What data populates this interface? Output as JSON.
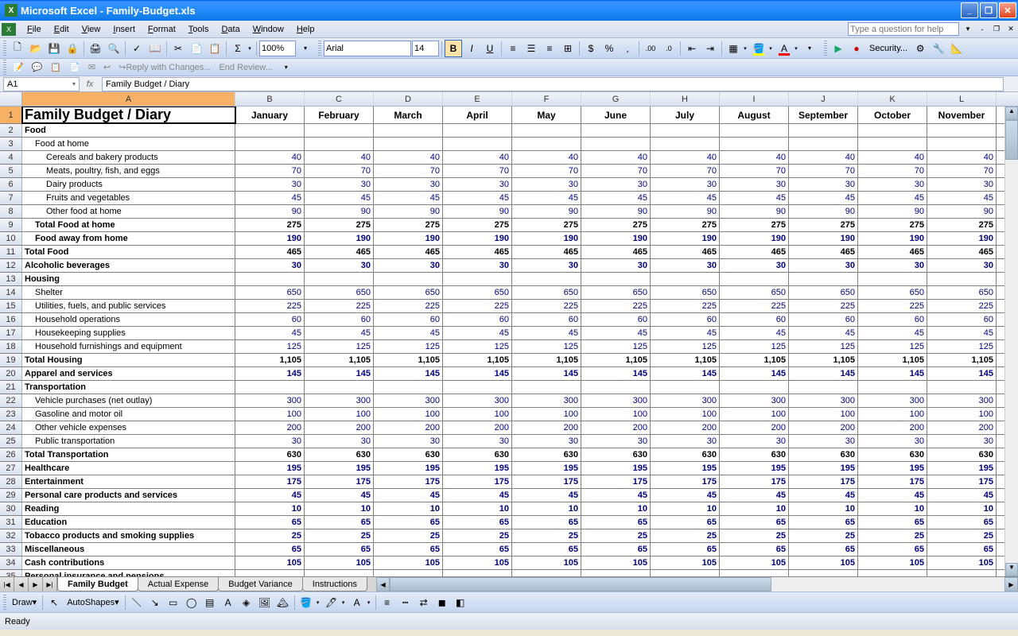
{
  "title": "Microsoft Excel - Family-Budget.xls",
  "menu": [
    "File",
    "Edit",
    "View",
    "Insert",
    "Format",
    "Tools",
    "Data",
    "Window",
    "Help"
  ],
  "help_placeholder": "Type a question for help",
  "toolbar": {
    "font_name": "Arial",
    "font_size": "14",
    "zoom": "100%",
    "security_label": "Security..."
  },
  "review": {
    "reply": "Reply with Changes...",
    "end": "End Review..."
  },
  "namebox": "A1",
  "formula": "Family Budget / Diary",
  "columns": [
    "A",
    "B",
    "C",
    "D",
    "E",
    "F",
    "G",
    "H",
    "I",
    "J",
    "K",
    "L"
  ],
  "months": [
    "January",
    "February",
    "March",
    "April",
    "May",
    "June",
    "July",
    "August",
    "September",
    "October",
    "November"
  ],
  "rows": [
    {
      "n": 1,
      "type": "header",
      "label": "Family Budget / Diary"
    },
    {
      "n": 2,
      "label": "Food",
      "bold": true,
      "vals": []
    },
    {
      "n": 3,
      "label": "Food at home",
      "indent": 1,
      "vals": []
    },
    {
      "n": 4,
      "label": "Cereals and bakery products",
      "indent": 2,
      "vals": [
        40,
        40,
        40,
        40,
        40,
        40,
        40,
        40,
        40,
        40,
        40
      ]
    },
    {
      "n": 5,
      "label": "Meats, poultry, fish, and eggs",
      "indent": 2,
      "vals": [
        70,
        70,
        70,
        70,
        70,
        70,
        70,
        70,
        70,
        70,
        70
      ]
    },
    {
      "n": 6,
      "label": "Dairy products",
      "indent": 2,
      "vals": [
        30,
        30,
        30,
        30,
        30,
        30,
        30,
        30,
        30,
        30,
        30
      ]
    },
    {
      "n": 7,
      "label": "Fruits and vegetables",
      "indent": 2,
      "vals": [
        45,
        45,
        45,
        45,
        45,
        45,
        45,
        45,
        45,
        45,
        45
      ]
    },
    {
      "n": 8,
      "label": "Other food at home",
      "indent": 2,
      "vals": [
        90,
        90,
        90,
        90,
        90,
        90,
        90,
        90,
        90,
        90,
        90
      ]
    },
    {
      "n": 9,
      "label": "Total Food at home",
      "bold": true,
      "indent": 1,
      "vals": [
        275,
        275,
        275,
        275,
        275,
        275,
        275,
        275,
        275,
        275,
        275
      ],
      "black": true
    },
    {
      "n": 10,
      "label": "Food away from home",
      "bold": true,
      "indent": 1,
      "vals": [
        190,
        190,
        190,
        190,
        190,
        190,
        190,
        190,
        190,
        190,
        190
      ]
    },
    {
      "n": 11,
      "label": "Total Food",
      "bold": true,
      "vals": [
        465,
        465,
        465,
        465,
        465,
        465,
        465,
        465,
        465,
        465,
        465
      ],
      "black": true
    },
    {
      "n": 12,
      "label": "Alcoholic beverages",
      "bold": true,
      "vals": [
        30,
        30,
        30,
        30,
        30,
        30,
        30,
        30,
        30,
        30,
        30
      ]
    },
    {
      "n": 13,
      "label": "Housing",
      "bold": true,
      "vals": []
    },
    {
      "n": 14,
      "label": "Shelter",
      "indent": 1,
      "vals": [
        650,
        650,
        650,
        650,
        650,
        650,
        650,
        650,
        650,
        650,
        650
      ]
    },
    {
      "n": 15,
      "label": "Utilities, fuels, and public services",
      "indent": 1,
      "vals": [
        225,
        225,
        225,
        225,
        225,
        225,
        225,
        225,
        225,
        225,
        225
      ]
    },
    {
      "n": 16,
      "label": "Household operations",
      "indent": 1,
      "vals": [
        60,
        60,
        60,
        60,
        60,
        60,
        60,
        60,
        60,
        60,
        60
      ]
    },
    {
      "n": 17,
      "label": "Housekeeping supplies",
      "indent": 1,
      "vals": [
        45,
        45,
        45,
        45,
        45,
        45,
        45,
        45,
        45,
        45,
        45
      ]
    },
    {
      "n": 18,
      "label": "Household furnishings and equipment",
      "indent": 1,
      "vals": [
        125,
        125,
        125,
        125,
        125,
        125,
        125,
        125,
        125,
        125,
        125
      ]
    },
    {
      "n": 19,
      "label": "Total Housing",
      "bold": true,
      "vals": [
        "1,105",
        "1,105",
        "1,105",
        "1,105",
        "1,105",
        "1,105",
        "1,105",
        "1,105",
        "1,105",
        "1,105",
        "1,105"
      ],
      "black": true
    },
    {
      "n": 20,
      "label": "Apparel and services",
      "bold": true,
      "vals": [
        145,
        145,
        145,
        145,
        145,
        145,
        145,
        145,
        145,
        145,
        145
      ]
    },
    {
      "n": 21,
      "label": "Transportation",
      "bold": true,
      "vals": []
    },
    {
      "n": 22,
      "label": "Vehicle purchases (net outlay)",
      "indent": 1,
      "vals": [
        300,
        300,
        300,
        300,
        300,
        300,
        300,
        300,
        300,
        300,
        300
      ]
    },
    {
      "n": 23,
      "label": "Gasoline and motor oil",
      "indent": 1,
      "vals": [
        100,
        100,
        100,
        100,
        100,
        100,
        100,
        100,
        100,
        100,
        100
      ]
    },
    {
      "n": 24,
      "label": "Other vehicle expenses",
      "indent": 1,
      "vals": [
        200,
        200,
        200,
        200,
        200,
        200,
        200,
        200,
        200,
        200,
        200
      ]
    },
    {
      "n": 25,
      "label": "Public transportation",
      "indent": 1,
      "vals": [
        30,
        30,
        30,
        30,
        30,
        30,
        30,
        30,
        30,
        30,
        30
      ]
    },
    {
      "n": 26,
      "label": "Total Transportation",
      "bold": true,
      "vals": [
        630,
        630,
        630,
        630,
        630,
        630,
        630,
        630,
        630,
        630,
        630
      ],
      "black": true
    },
    {
      "n": 27,
      "label": "Healthcare",
      "bold": true,
      "vals": [
        195,
        195,
        195,
        195,
        195,
        195,
        195,
        195,
        195,
        195,
        195
      ]
    },
    {
      "n": 28,
      "label": "Entertainment",
      "bold": true,
      "vals": [
        175,
        175,
        175,
        175,
        175,
        175,
        175,
        175,
        175,
        175,
        175
      ]
    },
    {
      "n": 29,
      "label": "Personal care products and services",
      "bold": true,
      "vals": [
        45,
        45,
        45,
        45,
        45,
        45,
        45,
        45,
        45,
        45,
        45
      ]
    },
    {
      "n": 30,
      "label": "Reading",
      "bold": true,
      "vals": [
        10,
        10,
        10,
        10,
        10,
        10,
        10,
        10,
        10,
        10,
        10
      ]
    },
    {
      "n": 31,
      "label": "Education",
      "bold": true,
      "vals": [
        65,
        65,
        65,
        65,
        65,
        65,
        65,
        65,
        65,
        65,
        65
      ]
    },
    {
      "n": 32,
      "label": "Tobacco products and smoking supplies",
      "bold": true,
      "vals": [
        25,
        25,
        25,
        25,
        25,
        25,
        25,
        25,
        25,
        25,
        25
      ]
    },
    {
      "n": 33,
      "label": "Miscellaneous",
      "bold": true,
      "vals": [
        65,
        65,
        65,
        65,
        65,
        65,
        65,
        65,
        65,
        65,
        65
      ]
    },
    {
      "n": 34,
      "label": "Cash contributions",
      "bold": true,
      "vals": [
        105,
        105,
        105,
        105,
        105,
        105,
        105,
        105,
        105,
        105,
        105
      ]
    },
    {
      "n": 35,
      "label": "Personal insurance and pensions",
      "bold": true,
      "vals": []
    }
  ],
  "sheets": [
    "Family Budget",
    "Actual Expense",
    "Budget Variance",
    "Instructions"
  ],
  "draw": {
    "draw": "Draw",
    "autoshapes": "AutoShapes"
  },
  "status": "Ready"
}
